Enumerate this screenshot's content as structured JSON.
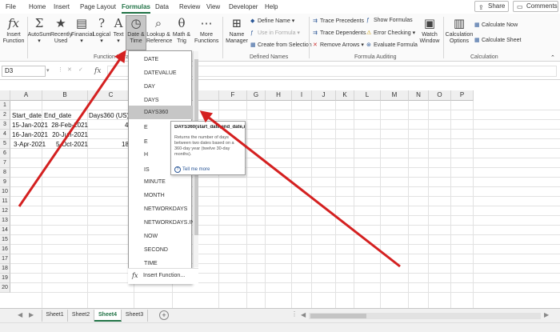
{
  "ribbon_tabs": [
    "File",
    "Home",
    "Insert",
    "Page Layout",
    "Formulas",
    "Data",
    "Review",
    "View",
    "Developer",
    "Help"
  ],
  "active_tab": "Formulas",
  "share_label": "Share",
  "comments_label": "Comments",
  "ribbon": {
    "insert_function": [
      "Insert",
      "Function"
    ],
    "autosum": [
      "AutoSum"
    ],
    "recently_used": [
      "Recently",
      "Used"
    ],
    "financial": [
      "Financial"
    ],
    "logical": [
      "Logical"
    ],
    "text": [
      "Text"
    ],
    "date_time": [
      "Date &",
      "Time"
    ],
    "lookup": [
      "Lookup &",
      "Reference"
    ],
    "math_trig": [
      "Math &",
      "Trig"
    ],
    "more_functions": [
      "More",
      "Functions"
    ],
    "function_library_label": "Function Library",
    "name_manager": [
      "Name",
      "Manager"
    ],
    "define_name": "Define Name",
    "use_in_formula": "Use in Formula",
    "create_from_selection": "Create from Selection",
    "defined_names_label": "Defined Names",
    "trace_precedents": "Trace Precedents",
    "trace_dependents": "Trace Dependents",
    "remove_arrows": "Remove Arrows",
    "show_formulas": "Show Formulas",
    "error_checking": "Error Checking",
    "evaluate_formula": "Evaluate Formula",
    "formula_auditing_label": "Formula Auditing",
    "watch_window": [
      "Watch",
      "Window"
    ],
    "calculation_options": [
      "Calculation",
      "Options"
    ],
    "calculate_now": "Calculate Now",
    "calculate_sheet": "Calculate Sheet",
    "calculation_label": "Calculation"
  },
  "name_box": "D3",
  "fx_label": "fx",
  "columns": [
    "A",
    "B",
    "C",
    "D",
    "E",
    "F",
    "G",
    "H",
    "I",
    "J",
    "K",
    "L",
    "M",
    "N",
    "O",
    "P"
  ],
  "rows": [
    "1",
    "2",
    "3",
    "4",
    "5",
    "6",
    "7",
    "8",
    "9",
    "10",
    "11",
    "12",
    "13",
    "14",
    "15",
    "16",
    "17",
    "18",
    "19",
    "20"
  ],
  "cells": {
    "a2": "Start_date",
    "b2": "End_date",
    "c2": "Days360 (US)",
    "a3": "15-Jan-2021",
    "b3": "28-Feb-2021",
    "a4": "16-Jan-2021",
    "b4": "20-Jun-2021",
    "a5": "3-Apr-2021",
    "b5": "5-Oct-2021",
    "c3_fragment": "4",
    "c5_fragment": "18"
  },
  "dropdown_items": [
    "DATE",
    "DATEVALUE",
    "DAY",
    "DAYS",
    "DAYS360",
    "EDATE",
    "EOMONTH",
    "HOUR",
    "ISOWEEKNUM",
    "MINUTE",
    "MONTH",
    "NETWORKDAYS",
    "NETWORKDAYS.INTL",
    "NOW",
    "SECOND",
    "TIME"
  ],
  "dropdown_visible_text": [
    "DATE",
    "DATEVALUE",
    "DAY",
    "DAYS",
    "DAYS360",
    "E",
    "E",
    "H",
    "IS",
    "MINUTE",
    "MONTH",
    "NETWORKDAYS",
    "NETWORKDAYS.INTL",
    "NOW",
    "SECOND",
    "TIME"
  ],
  "dropdown_highlighted": "DAYS360",
  "insert_function_item": "Insert Function...",
  "tooltip": {
    "title": "DAYS360(start_date,end_date,method)",
    "description": "Returns the number of days between two dates based on a 360-day year (twelve 30-day months).",
    "tell_me_more": "Tell me more"
  },
  "sheet_tabs": [
    "Sheet1",
    "Sheet2",
    "Sheet4",
    "Sheet3"
  ],
  "active_sheet": "Sheet4",
  "colors": {
    "excel_green": "#217346",
    "annotation_red": "#d42020",
    "link_blue": "#2b5797"
  }
}
